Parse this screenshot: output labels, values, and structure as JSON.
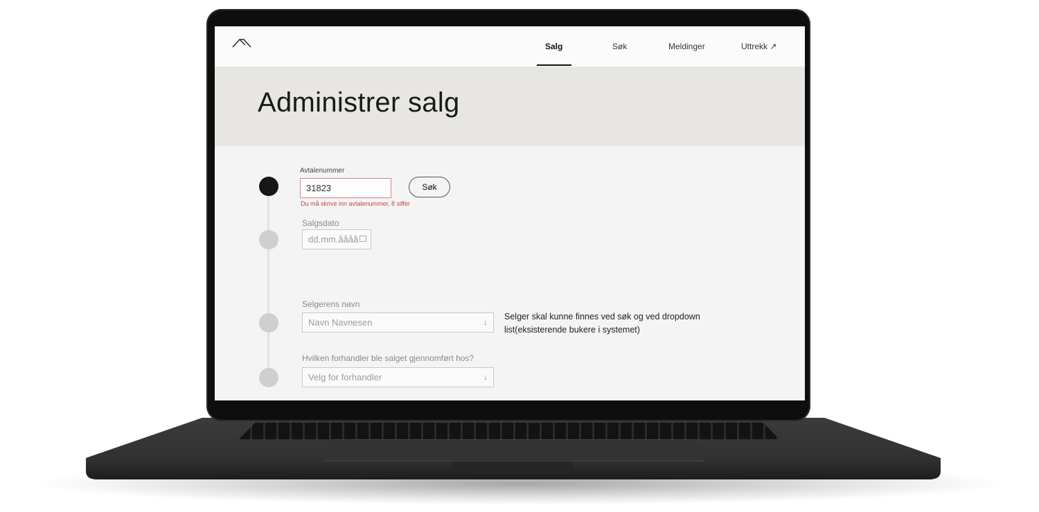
{
  "nav": {
    "items": [
      {
        "label": "Salg",
        "active": true
      },
      {
        "label": "Søk"
      },
      {
        "label": "Meldinger"
      },
      {
        "label": "Uttrekk ↗"
      }
    ],
    "logo_icon": "mountain-chevron-icon"
  },
  "page": {
    "title": "Administrer salg"
  },
  "form": {
    "avtale": {
      "label": "Avtalenummer",
      "value": "31823",
      "error": "Du må skrive inn avtalenummer, 8 siffer",
      "search_button": "Søk"
    },
    "salgsdato": {
      "label": "Salgsdato",
      "placeholder": "dd.mm.åååå",
      "icon": "calendar-icon"
    },
    "selger": {
      "label": "Selgerens navn",
      "placeholder": "Navn Navnesen",
      "note": "Selger skal kunne finnes ved søk og ved dropdown list(eksisterende bukere i systemet)"
    },
    "forhandler": {
      "label": "Hvilken forhandler ble salget gjennomført hos?",
      "placeholder": "Velg for forhandler"
    },
    "dropdown_arrow": "↓"
  },
  "colors": {
    "accent": "#111111",
    "error": "#c0484b",
    "hero_bg": "#e7e6e3"
  }
}
